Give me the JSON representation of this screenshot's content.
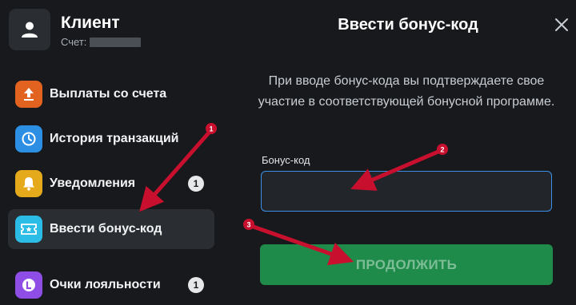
{
  "client": {
    "name": "Клиент",
    "account_label": "Счет:"
  },
  "sidebar": {
    "items": [
      {
        "label": "Выплаты со счета",
        "icon": "withdraw-icon",
        "color": "#e2621f",
        "badge": null,
        "active": false
      },
      {
        "label": "История транзакций",
        "icon": "clock-icon",
        "color": "#2d8fe4",
        "badge": null,
        "active": false
      },
      {
        "label": "Уведомления",
        "icon": "bell-icon",
        "color": "#e5a91c",
        "badge": "1",
        "active": false
      },
      {
        "label": "Ввести бонус-код",
        "icon": "ticket-icon",
        "color": "#2bbde6",
        "badge": null,
        "active": true
      },
      {
        "label": "Очки лояльности",
        "icon": "loyalty-icon",
        "color": "#8e4ee6",
        "badge": "1",
        "active": false
      }
    ]
  },
  "panel": {
    "title": "Ввести бонус-код",
    "description": "При вводе бонус-кода вы подтверждаете свое участие в соответствующей бонусной программе.",
    "field_label": "Бонус-код",
    "input_value": "",
    "submit_label": "ПРОДОЛЖИТЬ"
  },
  "annotations": {
    "color": "#c8102e",
    "markers": [
      "1",
      "2",
      "3"
    ]
  },
  "colors": {
    "background": "#17191c",
    "active_item": "#2a2d31",
    "input_border": "#3d8fe6",
    "submit_background": "#1f8b4b"
  }
}
